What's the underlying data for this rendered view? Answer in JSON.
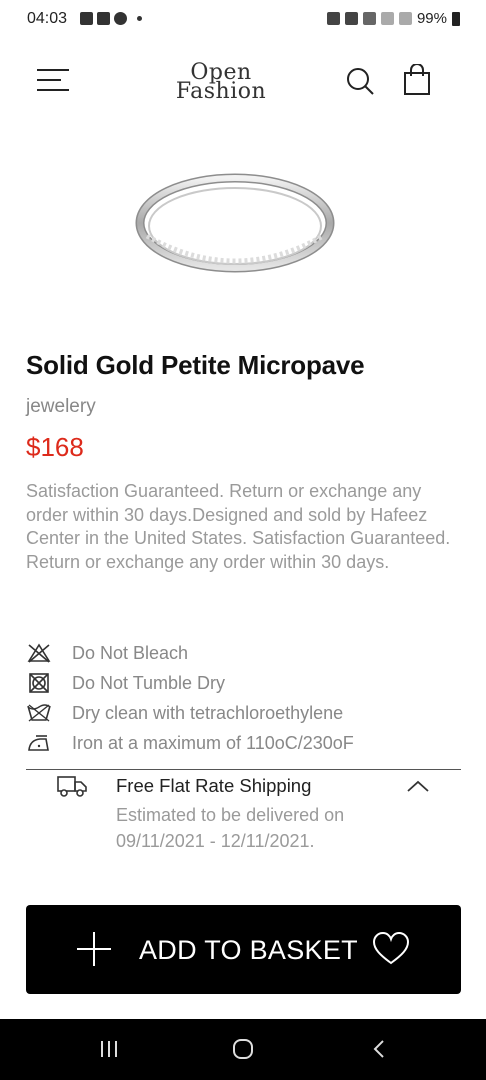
{
  "status_bar": {
    "time": "04:03",
    "battery": "99%"
  },
  "header": {
    "logo_line1": "Open",
    "logo_line2": "Fashion"
  },
  "product": {
    "title": "Solid Gold Petite Micropave",
    "category": "jewelery",
    "price": "$168",
    "description": "Satisfaction Guaranteed. Return or exchange any order within 30 days.Designed and sold by Hafeez Center in the United States. Satisfaction Guaranteed. Return or exchange any order within 30 days."
  },
  "care": [
    {
      "icon": "no-bleach-icon",
      "label": "Do Not Bleach"
    },
    {
      "icon": "no-tumble-dry-icon",
      "label": "Do Not Tumble Dry"
    },
    {
      "icon": "dry-clean-icon",
      "label": "Dry clean with tetrachloroethylene"
    },
    {
      "icon": "iron-icon",
      "label": "Iron at a maximum of 110oC/230oF"
    }
  ],
  "shipping": {
    "title": "Free Flat Rate Shipping",
    "estimate": "Estimated to be delivered on 09/11/2021 - 12/11/2021."
  },
  "cta": {
    "label": "ADD TO BASKET"
  },
  "colors": {
    "accent_price": "#dd2a1b",
    "button_bg": "#000000"
  }
}
